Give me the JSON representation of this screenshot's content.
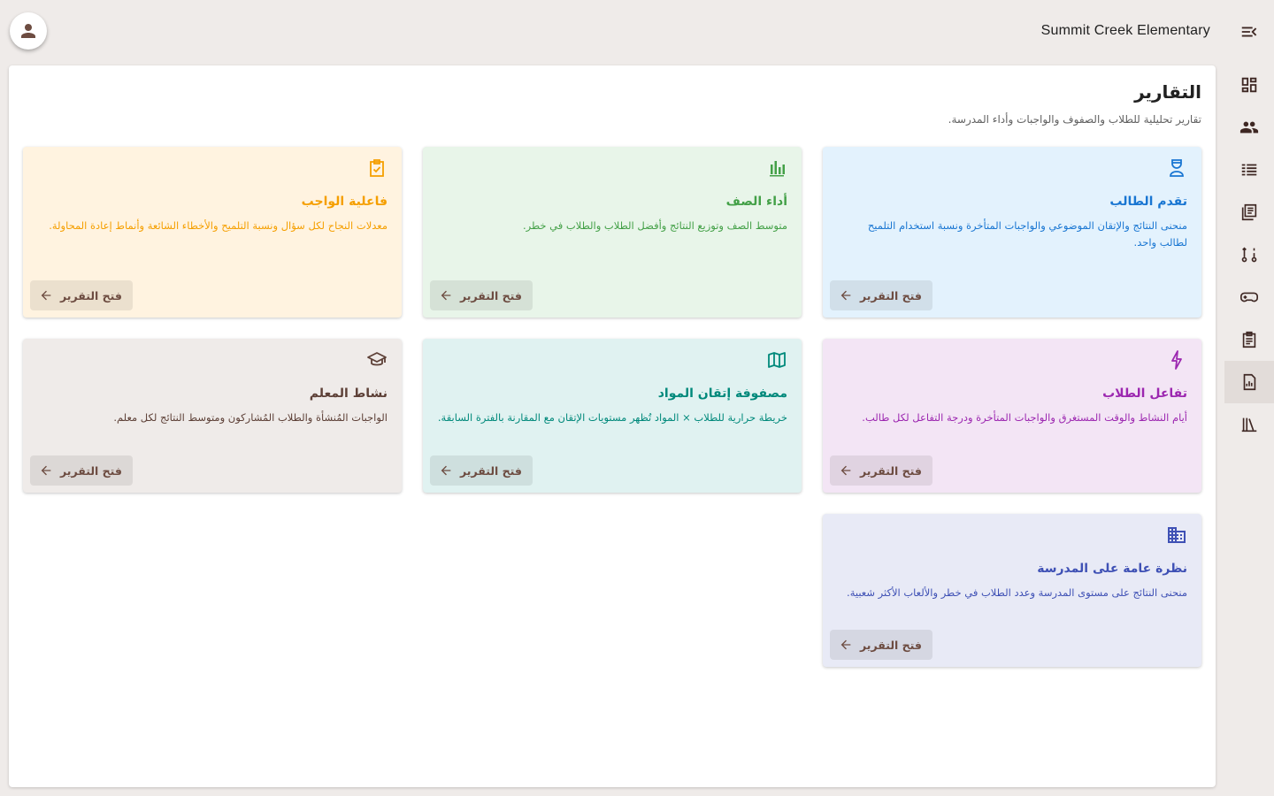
{
  "header": {
    "school_name": "Summit Creek Elementary",
    "avatar_icon": "person-icon",
    "menu_icon": "menu-open-icon"
  },
  "rail": {
    "active_index": 7,
    "items": [
      "dashboard-icon",
      "people-icon",
      "list-icon",
      "library-books-icon",
      "route-icon",
      "gamepad-icon",
      "assignment-icon",
      "report-icon",
      "library-icon"
    ]
  },
  "page": {
    "title": "التقارير",
    "subtitle": "تقارير تحليلية للطلاب والصفوف والواجبات وأداء المدرسة."
  },
  "cards": [
    {
      "title": "تقدم الطالب",
      "desc": "منحنى النتائج والإتقان الموضوعي والواجبات المتأخرة ونسبة استخدام التلميح لطالب واحد.",
      "button": "فتح التقرير",
      "color": "#1976d2",
      "icon": "student-icon"
    },
    {
      "title": "أداء الصف",
      "desc": "متوسط الصف وتوزيع النتائج وأفضل الطلاب والطلاب في خطر.",
      "button": "فتح التقرير",
      "color": "#43a047",
      "icon": "bar-chart-icon"
    },
    {
      "title": "فاعلية الواجب",
      "desc": "معدلات النجاح لكل سؤال ونسبة التلميح والأخطاء الشائعة وأنماط إعادة المحاولة.",
      "button": "فتح التقرير",
      "color": "#f59f00",
      "icon": "assignment-check-icon"
    },
    {
      "title": "تفاعل الطلاب",
      "desc": "أيام النشاط والوقت المستغرق والواجبات المتأخرة ودرجة التفاعل لكل طالب.",
      "button": "فتح التقرير",
      "color": "#9c27b0",
      "icon": "bolt-icon"
    },
    {
      "title": "مصفوفة إتقان المواد",
      "desc": "خريطة حرارية للطلاب × المواد تُظهر مستويات الإتقان مع المقارنة بالفترة السابقة.",
      "button": "فتح التقرير",
      "color": "#00897b",
      "icon": "map-icon"
    },
    {
      "title": "نشاط المعلم",
      "desc": "الواجبات المُنشأة والطلاب المُشاركون ومتوسط النتائج لكل معلم.",
      "button": "فتح التقرير",
      "color": "#5d4037",
      "icon": "school-icon"
    },
    {
      "title": "نظرة عامة على المدرسة",
      "desc": "منحنى النتائج على مستوى المدرسة وعدد الطلاب في خطر والألعاب الأكثر شعبية.",
      "button": "فتح التقرير",
      "color": "#3f51b5",
      "icon": "building-icon"
    }
  ]
}
